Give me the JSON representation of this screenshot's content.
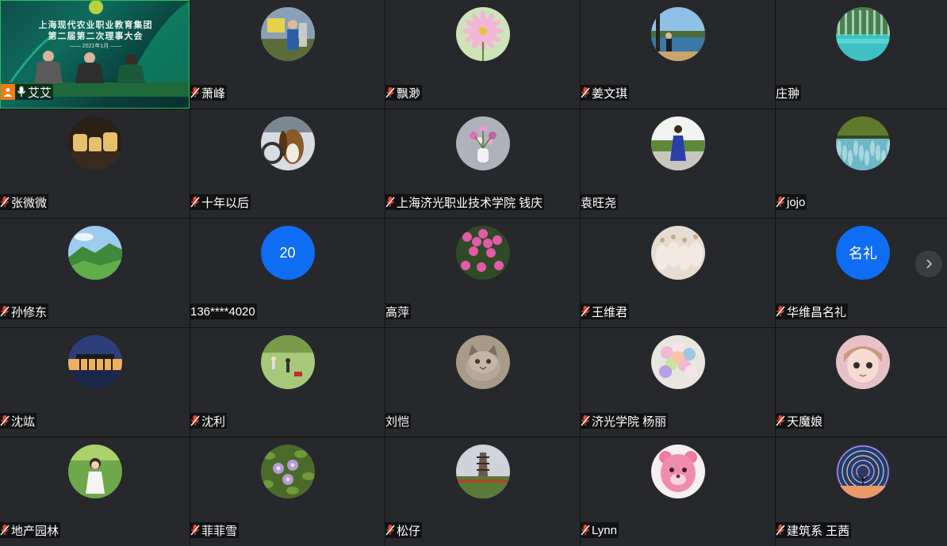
{
  "tiles": [
    {
      "name": "艾艾",
      "type": "video",
      "video": {
        "title_line1": "上海现代农业职业教育集团",
        "title_line2": "第二届第二次理事大会",
        "date_line": "2021年1月"
      }
    },
    {
      "name": "萧峰",
      "type": "photo",
      "avatar": "person-outdoor"
    },
    {
      "name": "飘渺",
      "type": "photo",
      "avatar": "pink-flower"
    },
    {
      "name": "姜文琪",
      "type": "photo",
      "avatar": "person-lake"
    },
    {
      "name": "庄翀",
      "type": "photo",
      "avatar": "turquoise-lake"
    },
    {
      "name": "张微微",
      "type": "photo",
      "avatar": "cartoon-figures"
    },
    {
      "name": "十年以后",
      "type": "photo",
      "avatar": "dog-driving"
    },
    {
      "name": "上海济光职业技术学院 钱庆",
      "type": "photo",
      "avatar": "flower-vase"
    },
    {
      "name": "袁旺尧",
      "type": "photo",
      "avatar": "person-blue-dress"
    },
    {
      "name": "jojo",
      "type": "photo",
      "avatar": "blue-field"
    },
    {
      "name": "孙修东",
      "type": "photo",
      "avatar": "green-mountains"
    },
    {
      "name": "136****4020",
      "type": "text",
      "avatar_text": "20"
    },
    {
      "name": "高萍",
      "type": "photo",
      "avatar": "pink-flowers"
    },
    {
      "name": "王维君",
      "type": "photo",
      "avatar": "ballet"
    },
    {
      "name": "华维昌名礼",
      "type": "text",
      "avatar_text": "名礼"
    },
    {
      "name": "沈竑",
      "type": "photo",
      "avatar": "sunset-pavilion"
    },
    {
      "name": "沈利",
      "type": "photo",
      "avatar": "lawn-mowing"
    },
    {
      "name": "刘恺",
      "type": "photo",
      "avatar": "cat"
    },
    {
      "name": "济光学院 杨丽",
      "type": "photo",
      "avatar": "flower-bouquet"
    },
    {
      "name": "天魔娘",
      "type": "photo",
      "avatar": "doll"
    },
    {
      "name": "地产园林",
      "type": "photo",
      "avatar": "girl-garden"
    },
    {
      "name": "菲菲雪",
      "type": "photo",
      "avatar": "purple-flowers"
    },
    {
      "name": "松仔",
      "type": "photo",
      "avatar": "pagoda"
    },
    {
      "name": "Lynn",
      "type": "photo",
      "avatar": "pink-bear"
    },
    {
      "name": "建筑系 王茜",
      "type": "photo",
      "avatar": "star-trails"
    }
  ],
  "colors": {
    "tile_bg": "#26282b",
    "active_border": "#2fbf55",
    "text_avatar_bg": "#0f6df4",
    "mic_muted": "#e8472e"
  },
  "icons": {
    "mic": "mic-muted-icon",
    "person": "person-icon",
    "next": "chevron-right-icon"
  }
}
